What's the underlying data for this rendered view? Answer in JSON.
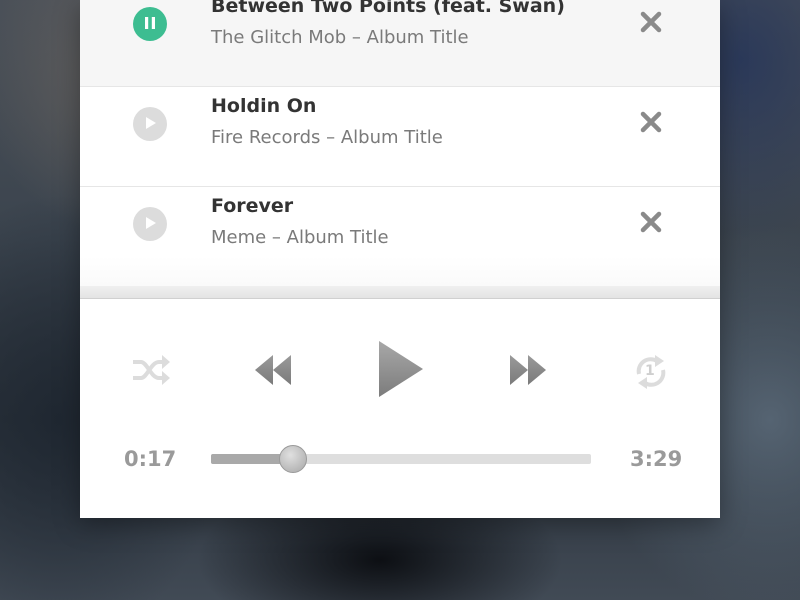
{
  "playlist": [
    {
      "title": "Between Two Points (feat. Swan)",
      "artist": "The Glitch Mob",
      "album": "Album Title",
      "subtitle": "The Glitch Mob – Album Title",
      "state": "playing"
    },
    {
      "title": "Holdin On",
      "artist": "Fire Records",
      "album": "Album Title",
      "subtitle": "Fire Records – Album Title",
      "state": "paused"
    },
    {
      "title": "Forever",
      "artist": "Meme",
      "album": "Album Title",
      "subtitle": "Meme – Album Title",
      "state": "paused"
    }
  ],
  "player": {
    "elapsed": "0:17",
    "duration": "3:29",
    "progress_fraction": 0.215,
    "repeat_badge": "1"
  },
  "icons": {
    "pause": "pause-icon",
    "play": "play-icon",
    "remove": "close-icon",
    "shuffle": "shuffle-icon",
    "previous": "rewind-icon",
    "main_play": "play-icon",
    "next": "fast-forward-icon",
    "repeat": "repeat-one-icon"
  },
  "colors": {
    "accent": "#3dbd91",
    "text_primary": "#333333",
    "text_secondary": "#7a7a7a",
    "control_gray": "#8f8f8f"
  }
}
